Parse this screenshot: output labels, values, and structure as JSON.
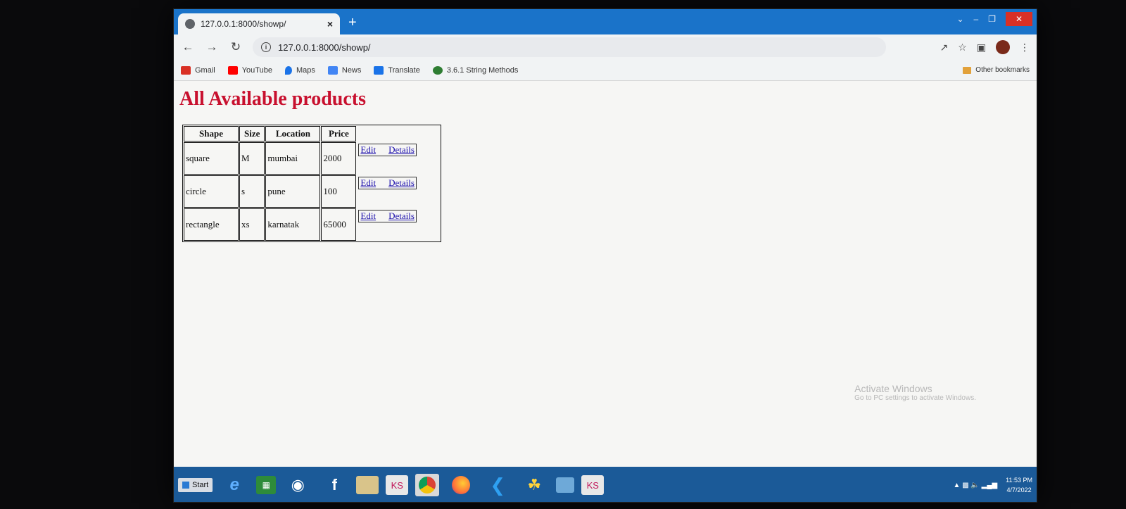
{
  "browser": {
    "tab_title": "127.0.0.1:8000/showp/",
    "tab_close": "×",
    "new_tab": "+",
    "url": "127.0.0.1:8000/showp/"
  },
  "bookmarks": [
    {
      "label": "Gmail",
      "color": "#d93025"
    },
    {
      "label": "YouTube",
      "color": "#ff0000"
    },
    {
      "label": "Maps",
      "color": "#1a73e8"
    },
    {
      "label": "News",
      "color": "#4285f4"
    },
    {
      "label": "Translate",
      "color": "#1a73e8"
    },
    {
      "label": "3.6.1 String Methods",
      "color": "#2e7d32"
    }
  ],
  "other_bookmarks": "Other bookmarks",
  "page": {
    "title": "All Available products",
    "columns": [
      "Shape",
      "Size",
      "Location",
      "Price"
    ],
    "rows": [
      {
        "shape": "square",
        "size": "M",
        "location": "mumbai",
        "price": "2000",
        "edit": "Edit",
        "details": "Details"
      },
      {
        "shape": "circle",
        "size": "s",
        "location": "pune",
        "price": "100",
        "edit": "Edit",
        "details": "Details"
      },
      {
        "shape": "rectangle",
        "size": "xs",
        "location": "karnatak",
        "price": "65000",
        "edit": "Edit",
        "details": "Details"
      }
    ]
  },
  "watermark": {
    "line1": "Activate Windows",
    "line2": "Go to PC settings to activate Windows."
  },
  "taskbar": {
    "start": "Start",
    "time": "11:53 PM",
    "date": "4/7/2022"
  },
  "colors": {
    "title_red": "#c8102e",
    "taskbar_blue": "#1b5a98",
    "tabstrip_blue": "#1a73c9"
  }
}
